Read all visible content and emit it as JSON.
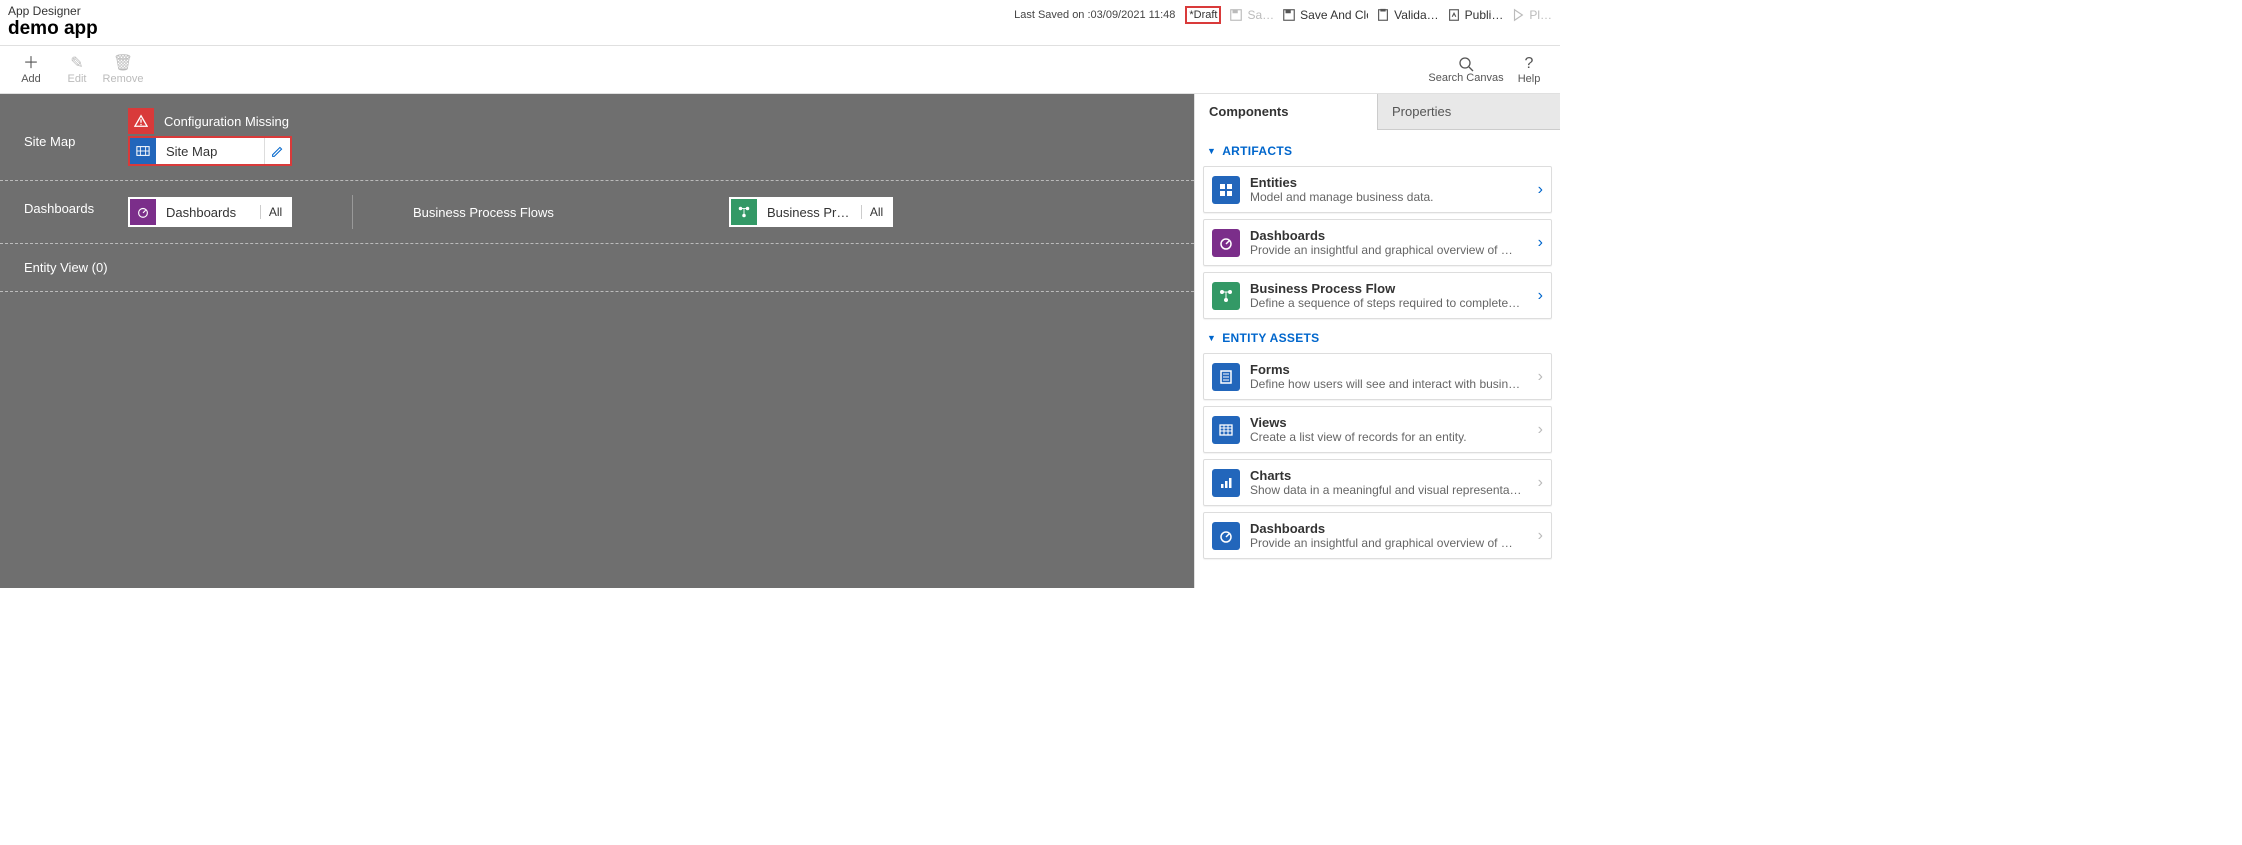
{
  "header": {
    "small_title": "App Designer",
    "app_name": "demo app",
    "last_saved": "Last Saved on :03/09/2021 11:48",
    "draft": "*Draft",
    "buttons": {
      "save": "Sa…",
      "save_close": "Save And Clo…",
      "validate": "Valida…",
      "publish": "Publi…",
      "play": "Pl…"
    }
  },
  "toolbar": {
    "add": "Add",
    "edit": "Edit",
    "remove": "Remove",
    "search": "Search Canvas",
    "help": "Help"
  },
  "canvas": {
    "sitemap_label": "Site Map",
    "config_missing": "Configuration Missing",
    "sitemap_tile": "Site Map",
    "dashboards_label": "Dashboards",
    "dashboards_tile": "Dashboards",
    "dashboards_badge": "All",
    "bpf_label": "Business Process Flows",
    "bpf_tile": "Business Proces…",
    "bpf_badge": "All",
    "entity_view": "Entity View (0)"
  },
  "panel": {
    "tab_components": "Components",
    "tab_properties": "Properties",
    "section_artifacts": "ARTIFACTS",
    "section_entity_assets": "ENTITY ASSETS",
    "cards": {
      "entities": {
        "title": "Entities",
        "desc": "Model and manage business data."
      },
      "dashboards": {
        "title": "Dashboards",
        "desc": "Provide an insightful and graphical overview of …"
      },
      "bpf": {
        "title": "Business Process Flow",
        "desc": "Define a sequence of steps required to complete…"
      },
      "forms": {
        "title": "Forms",
        "desc": "Define how users will see and interact with busin…"
      },
      "views": {
        "title": "Views",
        "desc": "Create a list view of records for an entity."
      },
      "charts": {
        "title": "Charts",
        "desc": "Show data in a meaningful and visual representa…"
      },
      "dashboards2": {
        "title": "Dashboards",
        "desc": "Provide an insightful and graphical overview of …"
      }
    }
  }
}
